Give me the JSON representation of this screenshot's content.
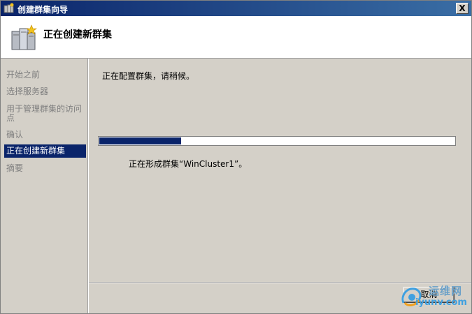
{
  "window": {
    "title": "创建群集向导",
    "close_label": "X"
  },
  "header": {
    "title": "正在创建新群集"
  },
  "sidebar": {
    "items": [
      {
        "label": "开始之前",
        "active": false
      },
      {
        "label": "选择服务器",
        "active": false
      },
      {
        "label": "用于管理群集的访问点",
        "active": false
      },
      {
        "label": "确认",
        "active": false
      },
      {
        "label": "正在创建新群集",
        "active": true
      },
      {
        "label": "摘要",
        "active": false
      }
    ]
  },
  "main": {
    "message": "正在配置群集，请稍候。",
    "progress_fraction": 0.23,
    "status": "正在形成群集“WinCluster1”。"
  },
  "footer": {
    "cancel_label": "取消"
  },
  "watermark": {
    "cn": "运维网",
    "en": "iyunv.com"
  },
  "colors": {
    "titlebar": "#0a246a",
    "selection": "#0a246a",
    "progress": "#0a246a",
    "dialog_bg": "#d4d0c8"
  }
}
